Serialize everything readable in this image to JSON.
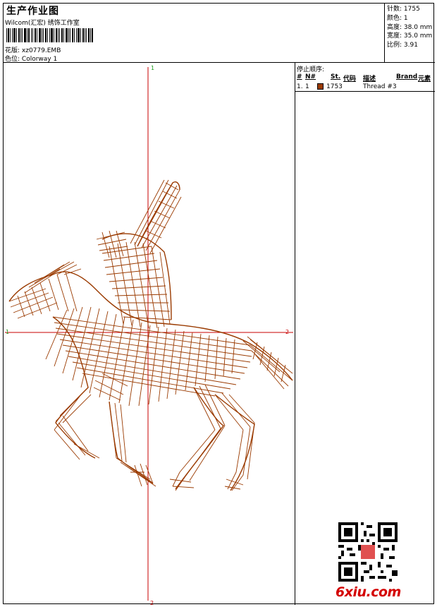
{
  "header": {
    "title": "生产作业图",
    "company": "Wilcom(汇宏) 绣饰工作室",
    "design_label": "花版:",
    "design_value": "xz0779.EMB",
    "colorway_label": "色位:",
    "colorway_value": "Colorway 1"
  },
  "stats": {
    "stitches": "针数: 1755",
    "colors": "颜色: 1",
    "height": "高度: 38.0 mm",
    "width": "宽度: 35.0 mm",
    "scale": "比例: 3.91"
  },
  "stop_sequence": {
    "title": "停止顺序:",
    "columns": [
      "#",
      "N#",
      "St.",
      "代码",
      "描述",
      "Brand",
      "元素"
    ],
    "rows": [
      {
        "idx": "1.",
        "needle": "1",
        "stitches": "1753",
        "desc": "Thread #3",
        "color": "#9a3a00"
      }
    ]
  },
  "crosshair": {
    "top": "1",
    "left": "1",
    "right": "2",
    "bottom": "2"
  },
  "branding": {
    "logo": "6xiu.com"
  },
  "colors": {
    "thread": "#9a3a00",
    "crosshair": "#c80000",
    "label": "#1a9c1a"
  }
}
